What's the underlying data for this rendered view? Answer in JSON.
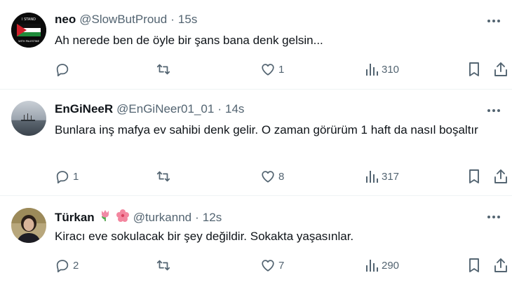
{
  "tweets": [
    {
      "name": "neo",
      "handle": "@SlowButProud",
      "separator": "·",
      "time": "15s",
      "text": "Ah nerede ben de öyle bir şans bana denk gelsin...",
      "replies": "",
      "retweets": "",
      "likes": "1",
      "views": "310",
      "avatar_text_top": "I STAND",
      "avatar_text_bottom": "WITH PALESTINE"
    },
    {
      "name": "EnGiNeeR",
      "handle": "@EnGiNeer01_01",
      "separator": "·",
      "time": "14s",
      "text": "Bunlara inş mafya ev sahibi denk gelir. O zaman görürüm 1 haft da nasıl boşaltır",
      "replies": "1",
      "retweets": "",
      "likes": "8",
      "views": "317"
    },
    {
      "name": "Türkan",
      "name_emojis": [
        "tulip-emoji",
        "hibiscus-emoji"
      ],
      "handle": "@turkannd",
      "separator": "·",
      "time": "12s",
      "text": "Kiracı eve sokulacak bir şey değildir. Sokakta yaşasınlar.",
      "replies": "2",
      "retweets": "",
      "likes": "7",
      "views": "290"
    }
  ],
  "icons": {
    "more": "more-icon",
    "reply": "reply-icon",
    "retweet": "retweet-icon",
    "like": "like-icon",
    "views": "views-icon",
    "bookmark": "bookmark-icon",
    "share": "share-icon"
  },
  "colors": {
    "text": "#0f1419",
    "secondary": "#536471",
    "divider": "#eff3f4"
  }
}
